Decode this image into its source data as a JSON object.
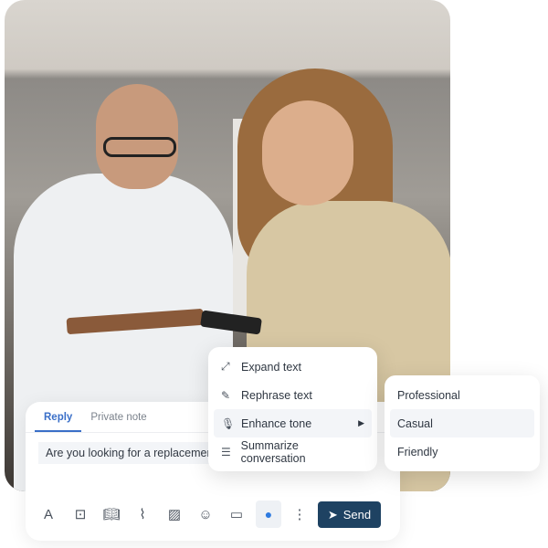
{
  "composer": {
    "tabs": [
      {
        "label": "Reply",
        "active": true
      },
      {
        "label": "Private note",
        "active": false
      }
    ],
    "message": "Are you looking for a replacement",
    "send_label": "Send",
    "toolbar_icons": [
      "text-format-icon",
      "canned-response-icon",
      "knowledge-base-icon",
      "attachment-icon",
      "image-icon",
      "emoji-icon",
      "calendar-icon",
      "ai-assist-icon",
      "more-icon"
    ]
  },
  "ai_menu": {
    "items": [
      {
        "label": "Expand text",
        "icon": "expand-icon"
      },
      {
        "label": "Rephrase text",
        "icon": "rephrase-icon"
      },
      {
        "label": "Enhance tone",
        "icon": "microphone-icon",
        "submenu": true
      },
      {
        "label": "Summarize conversation",
        "icon": "list-icon"
      }
    ]
  },
  "tone_menu": {
    "items": [
      {
        "label": "Professional"
      },
      {
        "label": "Casual",
        "highlighted": true
      },
      {
        "label": "Friendly"
      }
    ]
  },
  "colors": {
    "accent": "#3a6fc8",
    "send": "#1e4262"
  }
}
